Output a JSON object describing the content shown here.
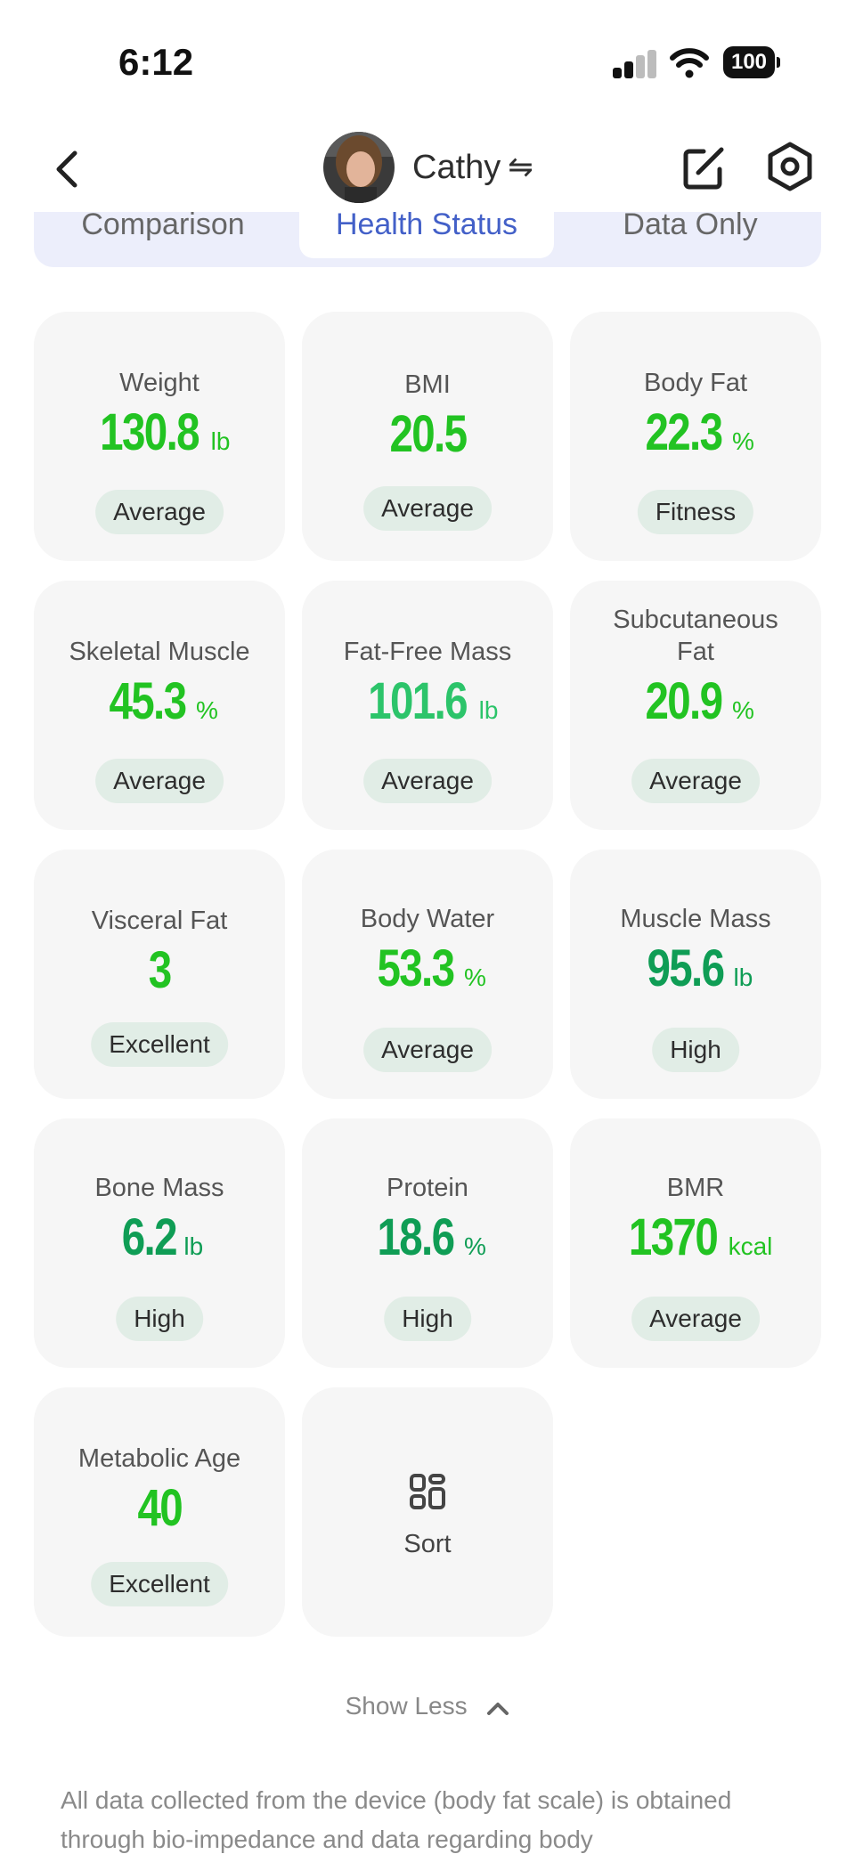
{
  "status_bar": {
    "time": "6:12",
    "battery": "100"
  },
  "header": {
    "user_name": "Cathy"
  },
  "tabs": [
    {
      "label": "Comparison"
    },
    {
      "label": "Health Status"
    },
    {
      "label": "Data Only"
    }
  ],
  "metrics": [
    {
      "label": "Weight",
      "value": "130.8",
      "unit": "lb",
      "status": "Average"
    },
    {
      "label": "BMI",
      "value": "20.5",
      "unit": "",
      "status": "Average"
    },
    {
      "label": "Body Fat",
      "value": "22.3",
      "unit": "%",
      "status": "Fitness"
    },
    {
      "label": "Skeletal Muscle",
      "value": "45.3",
      "unit": "%",
      "status": "Average"
    },
    {
      "label": "Fat-Free Mass",
      "value": "101.6",
      "unit": "lb",
      "status": "Average"
    },
    {
      "label": "Subcutaneous Fat",
      "value": "20.9",
      "unit": "%",
      "status": "Average"
    },
    {
      "label": "Visceral Fat",
      "value": "3",
      "unit": "",
      "status": "Excellent"
    },
    {
      "label": "Body Water",
      "value": "53.3",
      "unit": "%",
      "status": "Average"
    },
    {
      "label": "Muscle Mass",
      "value": "95.6",
      "unit": "lb",
      "status": "High"
    },
    {
      "label": "Bone Mass",
      "value": "6.2",
      "unit": "lb",
      "status": "High"
    },
    {
      "label": "Protein",
      "value": "18.6",
      "unit": "%",
      "status": "High"
    },
    {
      "label": "BMR",
      "value": "1370",
      "unit": "kcal",
      "status": "Average"
    },
    {
      "label": "Metabolic Age",
      "value": "40",
      "unit": "",
      "status": "Excellent"
    }
  ],
  "sort": {
    "label": "Sort"
  },
  "show_less": {
    "label": "Show Less"
  },
  "footnote": "All data collected from the device (body fat scale) is obtained through bio-impedance and data regarding body",
  "colors": {
    "accent": "#4360c8",
    "value_green_bright": "#22c322",
    "value_green_mid": "#2cc46a",
    "value_green_dark": "#0f9d55",
    "pill_bg": "#e1ede6",
    "card_bg": "#f6f6f6",
    "tab_bar_bg": "#eceefb"
  },
  "icons": {
    "back": "chevron-left-icon",
    "switch": "swap-arrows-icon",
    "edit": "edit-icon",
    "settings": "gear-icon",
    "sort": "grid-layout-icon",
    "show_less": "chevron-up-icon"
  }
}
